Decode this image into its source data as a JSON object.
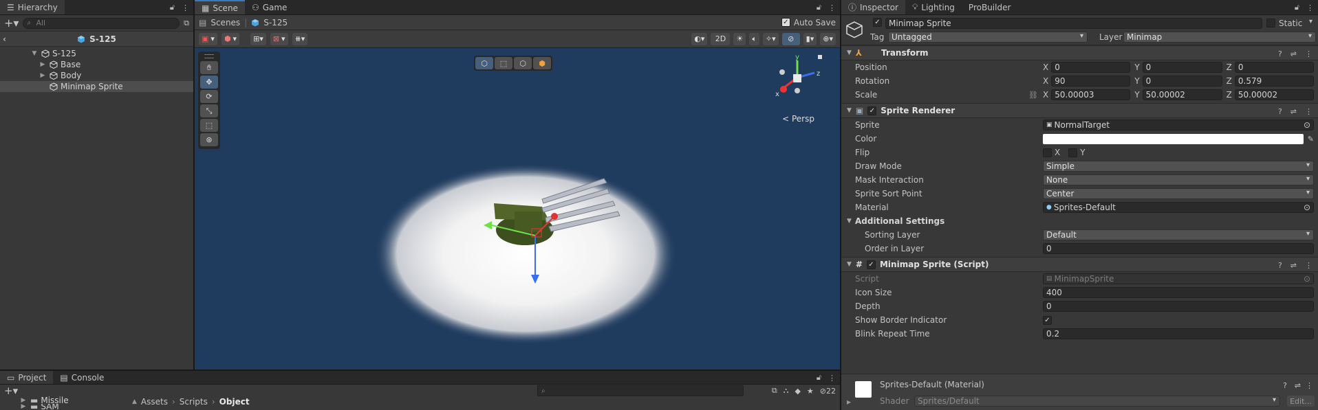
{
  "hierarchy": {
    "tab": "Hierarchy",
    "search_placeholder": "All",
    "root": "S-125",
    "tree": [
      {
        "label": "S-125",
        "depth": 0,
        "expanded": true
      },
      {
        "label": "Base",
        "depth": 1,
        "expanded": false
      },
      {
        "label": "Body",
        "depth": 1,
        "expanded": false
      },
      {
        "label": "Minimap Sprite",
        "depth": 1,
        "selected": true
      }
    ]
  },
  "scene": {
    "tabs": [
      "Scene",
      "Game"
    ],
    "breadcrumb": [
      "Scenes",
      "S-125"
    ],
    "auto_save_label": "Auto Save",
    "auto_save_checked": true,
    "btn_2d": "2D",
    "persp_label": "< Persp",
    "gizmo_axes": {
      "y": "y",
      "z": "z",
      "x": "x"
    }
  },
  "inspector": {
    "tabs": [
      "Inspector",
      "Lighting",
      "ProBuilder"
    ],
    "object_name": "Minimap Sprite",
    "static_label": "Static",
    "tag_label": "Tag",
    "tag_value": "Untagged",
    "layer_label": "Layer",
    "layer_value": "Minimap",
    "transform": {
      "title": "Transform",
      "position": {
        "label": "Position",
        "x": "0",
        "y": "0",
        "z": "0"
      },
      "rotation": {
        "label": "Rotation",
        "x": "90",
        "y": "0",
        "z": "0.579"
      },
      "scale": {
        "label": "Scale",
        "x": "50.00003",
        "y": "50.00002",
        "z": "50.00002"
      }
    },
    "sprite_renderer": {
      "title": "Sprite Renderer",
      "sprite_label": "Sprite",
      "sprite_value": "NormalTarget",
      "color_label": "Color",
      "flip_label": "Flip",
      "flip_x": "X",
      "flip_y": "Y",
      "draw_mode_label": "Draw Mode",
      "draw_mode_value": "Simple",
      "mask_label": "Mask Interaction",
      "mask_value": "None",
      "sort_point_label": "Sprite Sort Point",
      "sort_point_value": "Center",
      "material_label": "Material",
      "material_value": "Sprites-Default",
      "additional_label": "Additional Settings",
      "sorting_layer_label": "Sorting Layer",
      "sorting_layer_value": "Default",
      "order_label": "Order in Layer",
      "order_value": "0"
    },
    "minimap_script": {
      "title": "Minimap Sprite (Script)",
      "script_label": "Script",
      "script_value": "MinimapSprite",
      "icon_size_label": "Icon Size",
      "icon_size_value": "400",
      "depth_label": "Depth",
      "depth_value": "0",
      "border_label": "Show Border Indicator",
      "blink_label": "Blink Repeat Time",
      "blink_value": "0.2"
    },
    "material": {
      "title": "Sprites-Default (Material)",
      "shader_label": "Shader",
      "shader_value": "Sprites/Default",
      "edit_label": "Edit..."
    }
  },
  "project": {
    "tabs": [
      "Project",
      "Console"
    ],
    "path": [
      "Assets",
      "Scripts",
      "Object"
    ],
    "folders": [
      "Missile",
      "SAM"
    ],
    "hidden_count": "22"
  },
  "colors": {
    "accent": "#3a79bb",
    "viewport": "#1f3b5e",
    "panel": "#383838"
  }
}
